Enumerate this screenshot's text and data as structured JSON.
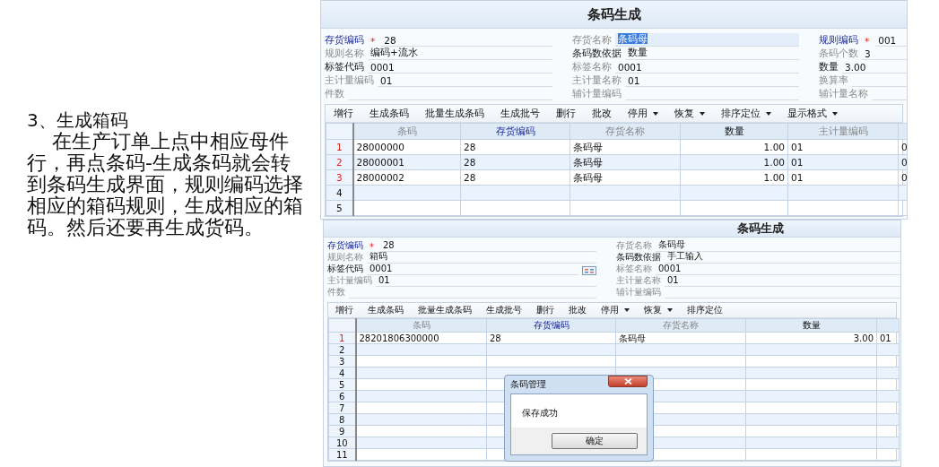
{
  "slide": {
    "heading": "3、生成箱码",
    "body": "在生产订单上点中相应母件行，再点条码-生成条码就会转到条码生成界面，规则编码选择相应的箱码规则，生成相应的箱码。然后还要再生成货码。"
  },
  "screens": [
    {
      "title": "条码生成",
      "form": [
        [
          {
            "label": "存货编码",
            "kind": "required",
            "marker": "*",
            "value": "28",
            "highlighted": false,
            "picker": false
          },
          {
            "label": "规则名称",
            "kind": "muted",
            "value": "编码+流水",
            "highlighted": false,
            "picker": false
          },
          {
            "label": "标签代码",
            "kind": "normal",
            "value": "0001",
            "highlighted": false,
            "picker": false
          },
          {
            "label": "主计量编码",
            "kind": "muted",
            "value": "01",
            "highlighted": false,
            "picker": false
          },
          {
            "label": "件数",
            "kind": "muted",
            "highlighted": false,
            "picker": false
          }
        ],
        [
          {
            "label": "存货名称",
            "kind": "muted",
            "value": "条码母",
            "highlighted": true,
            "picker": false
          },
          {
            "label": "条码数依据",
            "kind": "normal",
            "value": "数量",
            "highlighted": false,
            "picker": false
          },
          {
            "label": "标签名称",
            "kind": "muted",
            "value": "0001",
            "highlighted": false,
            "picker": false
          },
          {
            "label": "主计量名称",
            "kind": "muted",
            "value": "01",
            "highlighted": false,
            "picker": false
          },
          {
            "label": "辅计量编码",
            "kind": "muted",
            "highlighted": false,
            "picker": false
          }
        ],
        [
          {
            "label": "规则编码",
            "kind": "required",
            "marker": "*",
            "value": "001",
            "highlighted": false,
            "picker": false
          },
          {
            "label": "条码个数",
            "kind": "muted",
            "value": "3",
            "highlighted": false,
            "picker": false
          },
          {
            "label": "数量",
            "kind": "normal",
            "value": "3.00",
            "highlighted": false,
            "picker": false
          },
          {
            "label": "换算率",
            "kind": "muted",
            "highlighted": false,
            "picker": false
          },
          {
            "label": "辅计量名称",
            "kind": "muted",
            "highlighted": false,
            "picker": false
          }
        ]
      ],
      "toolbar": [
        {
          "label": "增行",
          "dropdown": false
        },
        {
          "label": "生成条码",
          "dropdown": false
        },
        {
          "label": "批量生成条码",
          "dropdown": false
        },
        {
          "label": "生成批号",
          "dropdown": false
        },
        {
          "label": "删行",
          "dropdown": false
        },
        {
          "label": "批改",
          "dropdown": false
        },
        {
          "label": "停用",
          "dropdown": true
        },
        {
          "label": "恢复",
          "dropdown": true
        },
        {
          "label": "排序定位",
          "dropdown": true
        },
        {
          "label": "显示格式",
          "dropdown": true
        }
      ],
      "columns": [
        {
          "label": "条码",
          "kind": "muted",
          "numeric": false
        },
        {
          "label": "存货编码",
          "kind": "key",
          "numeric": false
        },
        {
          "label": "存货名称",
          "kind": "muted",
          "numeric": false
        },
        {
          "label": "数量",
          "kind": "normal",
          "numeric": true
        },
        {
          "label": "主计量编码",
          "kind": "muted",
          "numeric": false
        },
        {
          "kind": "muted",
          "numeric": false
        }
      ],
      "rows": [
        {
          "number": "1",
          "flagged": true,
          "cells": [
            "28000000",
            "28",
            "条码母",
            "1.00",
            "01",
            "0"
          ]
        },
        {
          "number": "2",
          "flagged": true,
          "cells": [
            "28000001",
            "28",
            "条码母",
            "1.00",
            "01",
            "0"
          ]
        },
        {
          "number": "3",
          "flagged": true,
          "cells": [
            "28000002",
            "28",
            "条码母",
            "1.00",
            "01",
            "0"
          ]
        },
        {
          "number": "4",
          "flagged": false,
          "cells": []
        },
        {
          "number": "5",
          "flagged": false,
          "cells": []
        }
      ]
    },
    {
      "title": "条码生成",
      "form": [
        [
          {
            "label": "存货编码",
            "kind": "required",
            "marker": "*",
            "value": "28",
            "highlighted": false,
            "picker": false
          },
          {
            "label": "规则名称",
            "kind": "muted",
            "value": "箱码",
            "highlighted": false,
            "picker": false
          },
          {
            "label": "标签代码",
            "kind": "normal",
            "value": "0001",
            "highlighted": false,
            "picker": true
          },
          {
            "label": "主计量编码",
            "kind": "muted",
            "value": "01",
            "highlighted": false,
            "picker": false
          },
          {
            "label": "件数",
            "kind": "muted",
            "highlighted": false,
            "picker": false
          }
        ],
        [
          {
            "label": "存货名称",
            "kind": "muted",
            "value": "条码母",
            "highlighted": false,
            "picker": false
          },
          {
            "label": "条码数依据",
            "kind": "normal",
            "value": "手工输入",
            "highlighted": false,
            "picker": false
          },
          {
            "label": "标签名称",
            "kind": "muted",
            "value": "0001",
            "highlighted": false,
            "picker": false
          },
          {
            "label": "主计量名称",
            "kind": "muted",
            "value": "01",
            "highlighted": false,
            "picker": false
          },
          {
            "label": "辅计量编码",
            "kind": "muted",
            "highlighted": false,
            "picker": false
          }
        ]
      ],
      "toolbar": [
        {
          "label": "增行",
          "dropdown": false
        },
        {
          "label": "生成条码",
          "dropdown": false
        },
        {
          "label": "批量生成条码",
          "dropdown": false
        },
        {
          "label": "生成批号",
          "dropdown": false
        },
        {
          "label": "删行",
          "dropdown": false
        },
        {
          "label": "批改",
          "dropdown": false
        },
        {
          "label": "停用",
          "dropdown": true
        },
        {
          "label": "恢复",
          "dropdown": true
        },
        {
          "label": "排序定位",
          "dropdown": false
        }
      ],
      "columns": [
        {
          "label": "条码",
          "kind": "muted",
          "numeric": false
        },
        {
          "label": "存货编码",
          "kind": "key",
          "numeric": false
        },
        {
          "label": "存货名称",
          "kind": "muted",
          "numeric": false
        },
        {
          "label": "数量",
          "kind": "normal",
          "numeric": true
        },
        {
          "kind": "muted",
          "numeric": false
        }
      ],
      "rows": [
        {
          "number": "1",
          "flagged": true,
          "cells": [
            "28201806300000",
            "28",
            "条码母",
            "3.00",
            "01"
          ]
        },
        {
          "number": "2",
          "flagged": false,
          "cells": []
        },
        {
          "number": "3",
          "flagged": false,
          "cells": []
        },
        {
          "number": "4",
          "flagged": false,
          "cells": []
        },
        {
          "number": "5",
          "flagged": false,
          "cells": []
        },
        {
          "number": "6",
          "flagged": false,
          "cells": []
        },
        {
          "number": "7",
          "flagged": false,
          "cells": []
        },
        {
          "number": "8",
          "flagged": false,
          "cells": []
        },
        {
          "number": "9",
          "flagged": false,
          "cells": []
        },
        {
          "number": "10",
          "flagged": false,
          "cells": []
        },
        {
          "number": "11",
          "flagged": false,
          "cells": []
        }
      ],
      "dialog": {
        "title": "条码管理",
        "message": "保存成功",
        "button": "确定"
      }
    }
  ]
}
